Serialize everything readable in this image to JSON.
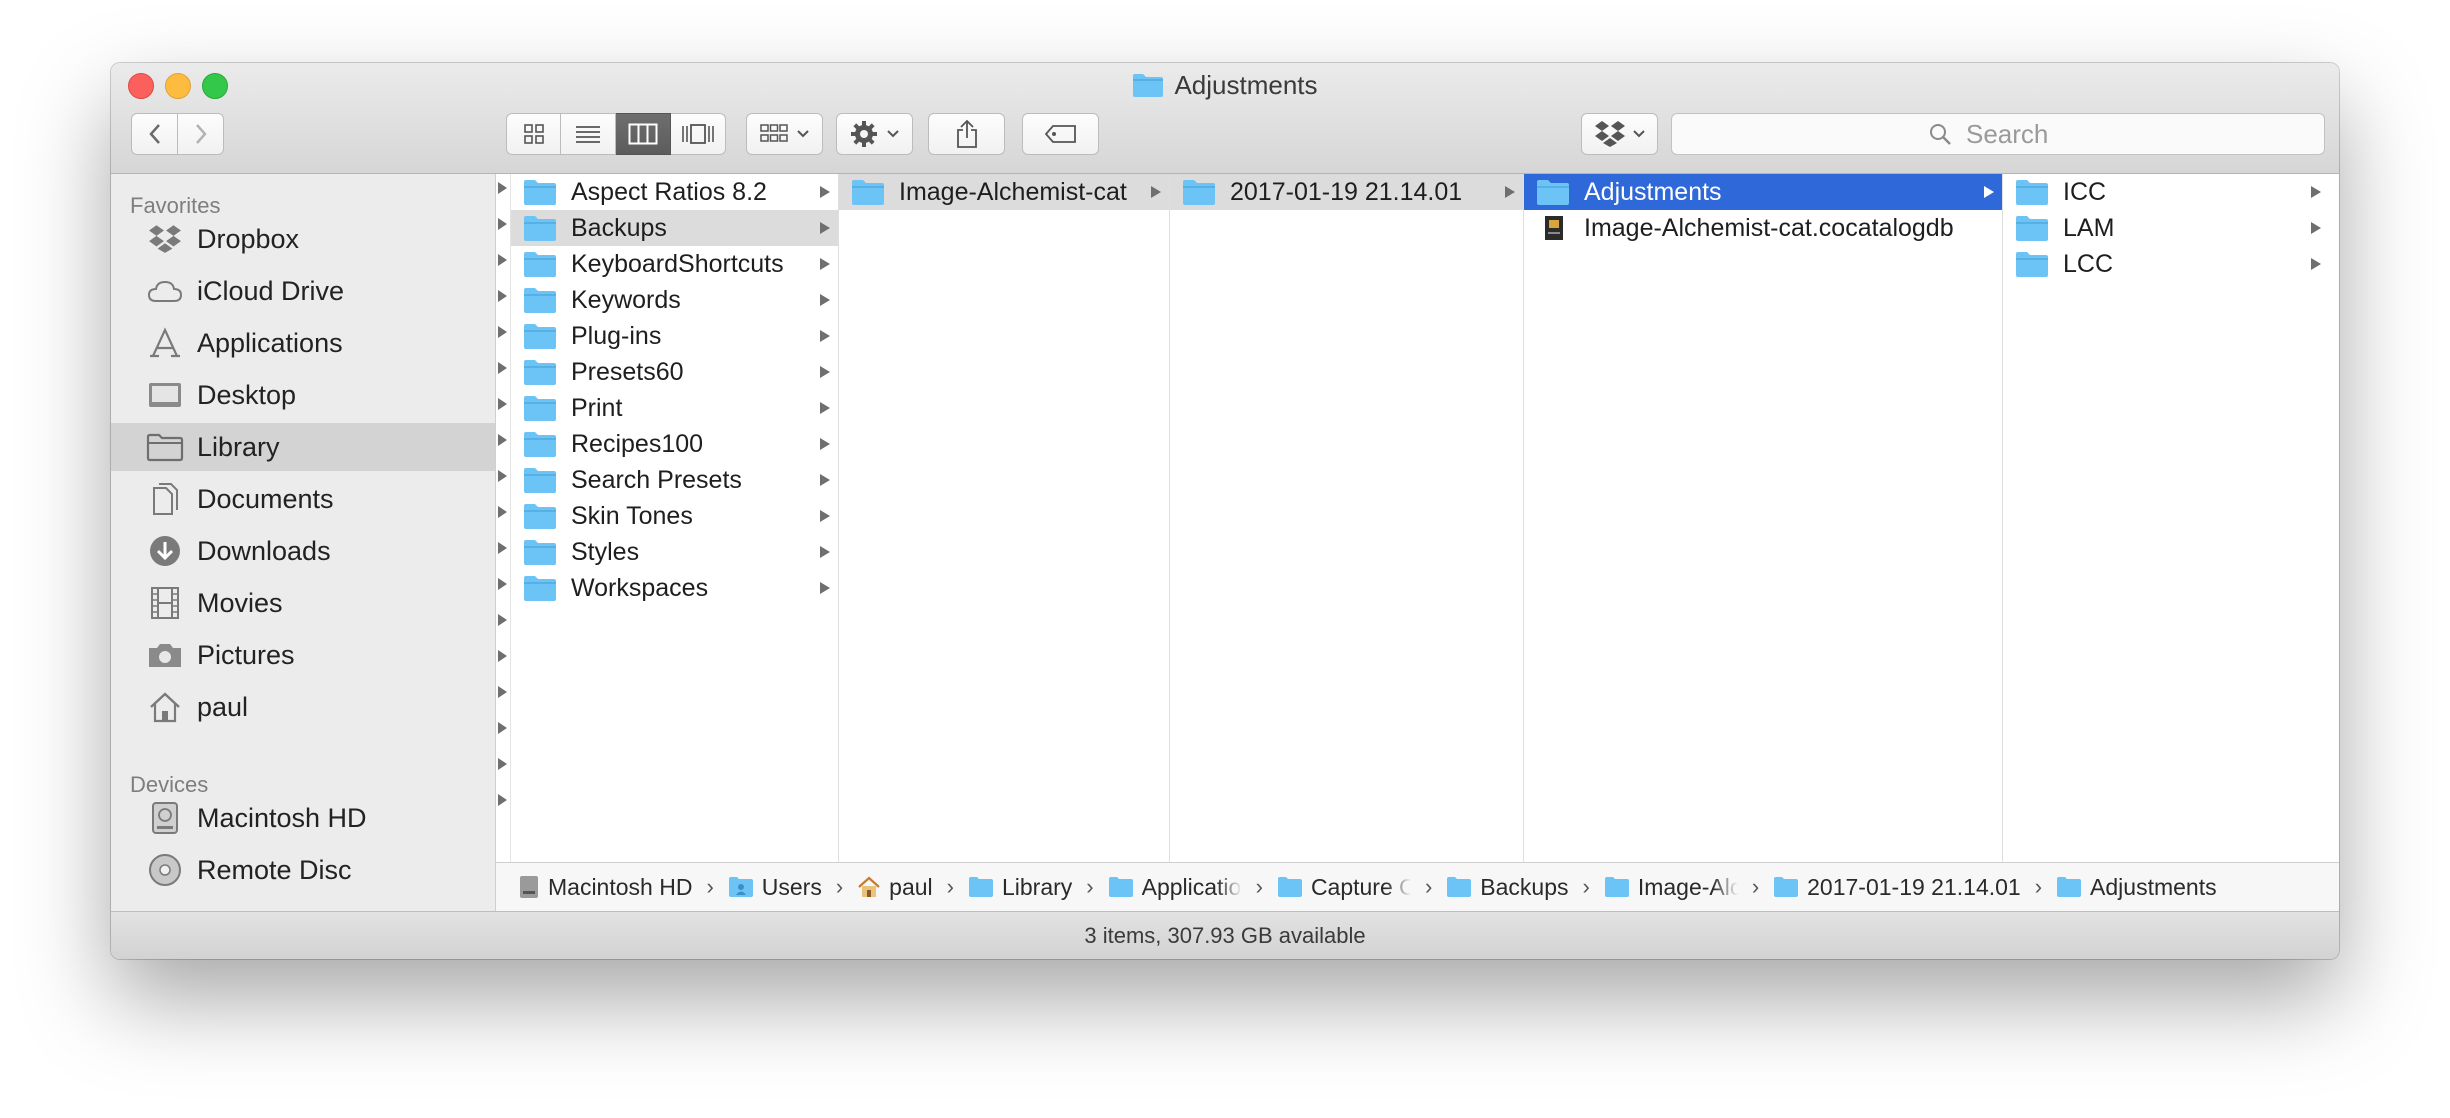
{
  "window": {
    "title": "Adjustments"
  },
  "toolbar": {
    "view_modes": [
      "icon-view",
      "list-view",
      "column-view",
      "cover-flow-view"
    ],
    "active_view": "column-view",
    "search_placeholder": "Search"
  },
  "sidebar": {
    "favorites_heading": "Favorites",
    "favorites": [
      {
        "label": "Dropbox",
        "icon": "dropbox-icon"
      },
      {
        "label": "iCloud Drive",
        "icon": "cloud-icon"
      },
      {
        "label": "Applications",
        "icon": "applications-icon"
      },
      {
        "label": "Desktop",
        "icon": "desktop-icon"
      },
      {
        "label": "Library",
        "icon": "folder-icon",
        "selected": true
      },
      {
        "label": "Documents",
        "icon": "documents-icon"
      },
      {
        "label": "Downloads",
        "icon": "downloads-icon"
      },
      {
        "label": "Movies",
        "icon": "movies-icon"
      },
      {
        "label": "Pictures",
        "icon": "camera-icon"
      },
      {
        "label": "paul",
        "icon": "home-icon"
      }
    ],
    "devices_heading": "Devices",
    "devices": [
      {
        "label": "Macintosh HD",
        "icon": "hard-drive-icon"
      },
      {
        "label": "Remote Disc",
        "icon": "disc-icon"
      }
    ]
  },
  "columns": [
    {
      "items": [
        {
          "label": "Aspect Ratios 8.2"
        },
        {
          "label": "Backups",
          "selected": true
        },
        {
          "label": "KeyboardShortcuts"
        },
        {
          "label": "Keywords"
        },
        {
          "label": "Plug-ins"
        },
        {
          "label": "Presets60"
        },
        {
          "label": "Print"
        },
        {
          "label": "Recipes100"
        },
        {
          "label": "Search Presets"
        },
        {
          "label": "Skin Tones"
        },
        {
          "label": "Styles"
        },
        {
          "label": "Workspaces"
        }
      ]
    },
    {
      "items": [
        {
          "label": "Image-Alchemist-cat",
          "selected": true
        }
      ]
    },
    {
      "items": [
        {
          "label": "2017-01-19 21.14.01",
          "selected": true
        }
      ]
    },
    {
      "items": [
        {
          "label": "Adjustments",
          "selected": true,
          "active": true
        },
        {
          "label": "Image-Alchemist-cat.cocatalogdb",
          "file": true
        }
      ]
    },
    {
      "items": [
        {
          "label": "ICC"
        },
        {
          "label": "LAM"
        },
        {
          "label": "LCC"
        }
      ]
    }
  ],
  "pathbar": [
    {
      "label": "Macintosh HD",
      "icon": "hard-drive-icon"
    },
    {
      "label": "Users",
      "icon": "users-folder-icon"
    },
    {
      "label": "paul",
      "icon": "home-icon"
    },
    {
      "label": "Library",
      "icon": "folder-icon"
    },
    {
      "label": "Application",
      "icon": "folder-icon",
      "truncated": true
    },
    {
      "label": "Capture On",
      "icon": "folder-icon",
      "truncated": true
    },
    {
      "label": "Backups",
      "icon": "folder-icon"
    },
    {
      "label": "Image-Alch",
      "icon": "folder-icon",
      "truncated": true
    },
    {
      "label": "2017-01-19 21.14.01",
      "icon": "folder-icon"
    },
    {
      "label": "Adjustments",
      "icon": "folder-icon"
    }
  ],
  "status": "3 items, 307.93 GB available",
  "colors": {
    "selection_blue": "#2f68d8",
    "folder_blue": "#6cc3f5",
    "close": "#fc605c",
    "minimize": "#fdbc40",
    "maximize": "#34c84a"
  }
}
